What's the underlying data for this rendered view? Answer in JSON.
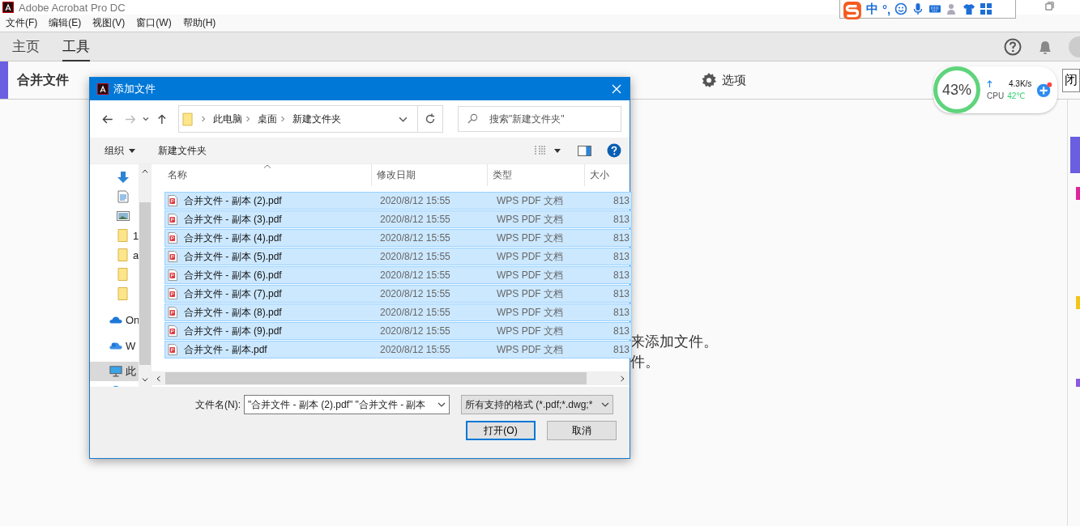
{
  "app": {
    "title": "Adobe Acrobat Pro DC",
    "menu": [
      "文件(F)",
      "编辑(E)",
      "视图(V)",
      "窗口(W)",
      "帮助(H)"
    ],
    "tabs": [
      {
        "label": "主页",
        "selected": false
      },
      {
        "label": "工具",
        "selected": true
      }
    ],
    "tool_title": "合并文件",
    "options_button": "选项",
    "close_button": "闭",
    "hint_lines": [
      "来添加文件。",
      "件。"
    ]
  },
  "ime_toolbar": {
    "mode": "中",
    "punctuation": "°,"
  },
  "monitor": {
    "percent": "43%",
    "speed": "4.3K/s",
    "cpu_label": "CPU",
    "cpu_temp": "42℃"
  },
  "dialog": {
    "title": "添加文件",
    "breadcrumb": [
      "此电脑",
      "桌面",
      "新建文件夹"
    ],
    "search": {
      "placeholder": "搜索\"新建文件夹\""
    },
    "toolbar": {
      "organize": "组织",
      "new_folder": "新建文件夹"
    },
    "nav_items": [
      {
        "kind": "download",
        "selected": false
      },
      {
        "kind": "document",
        "selected": false
      },
      {
        "kind": "image",
        "selected": false
      },
      {
        "kind": "folder",
        "label": "1",
        "selected": false
      },
      {
        "kind": "folder",
        "label": "a",
        "selected": false
      },
      {
        "kind": "folder",
        "selected": false
      },
      {
        "kind": "folder",
        "selected": false
      },
      {
        "kind": "cloud",
        "label": "On",
        "selected": false
      },
      {
        "kind": "cloud2",
        "label": "W",
        "selected": false
      },
      {
        "kind": "pc",
        "label": "此",
        "selected": true
      },
      {
        "kind": "network",
        "selected": false
      }
    ],
    "columns": [
      "名称",
      "修改日期",
      "类型",
      "大小"
    ],
    "files": [
      {
        "name": "合并文件 - 副本 (2).pdf",
        "date": "2020/8/12 15:55",
        "type": "WPS PDF 文档",
        "size": "813",
        "selected": true
      },
      {
        "name": "合并文件 - 副本 (3).pdf",
        "date": "2020/8/12 15:55",
        "type": "WPS PDF 文档",
        "size": "813",
        "selected": true
      },
      {
        "name": "合并文件 - 副本 (4).pdf",
        "date": "2020/8/12 15:55",
        "type": "WPS PDF 文档",
        "size": "813",
        "selected": true
      },
      {
        "name": "合并文件 - 副本 (5).pdf",
        "date": "2020/8/12 15:55",
        "type": "WPS PDF 文档",
        "size": "813",
        "selected": true
      },
      {
        "name": "合并文件 - 副本 (6).pdf",
        "date": "2020/8/12 15:55",
        "type": "WPS PDF 文档",
        "size": "813",
        "selected": true
      },
      {
        "name": "合并文件 - 副本 (7).pdf",
        "date": "2020/8/12 15:55",
        "type": "WPS PDF 文档",
        "size": "813",
        "selected": true
      },
      {
        "name": "合并文件 - 副本 (8).pdf",
        "date": "2020/8/12 15:55",
        "type": "WPS PDF 文档",
        "size": "813",
        "selected": true
      },
      {
        "name": "合并文件 - 副本 (9).pdf",
        "date": "2020/8/12 15:55",
        "type": "WPS PDF 文档",
        "size": "813",
        "selected": true
      },
      {
        "name": "合并文件 - 副本.pdf",
        "date": "2020/8/12 15:55",
        "type": "WPS PDF 文档",
        "size": "813",
        "selected": true
      }
    ],
    "filename_label": "文件名(N):",
    "filename_value": "\"合并文件 - 副本 (2).pdf\" \"合并文件 - 副本",
    "filter": "所有支持的格式 (*.pdf;*.dwg;*",
    "open_button": "打开(O)",
    "cancel_button": "取消"
  }
}
